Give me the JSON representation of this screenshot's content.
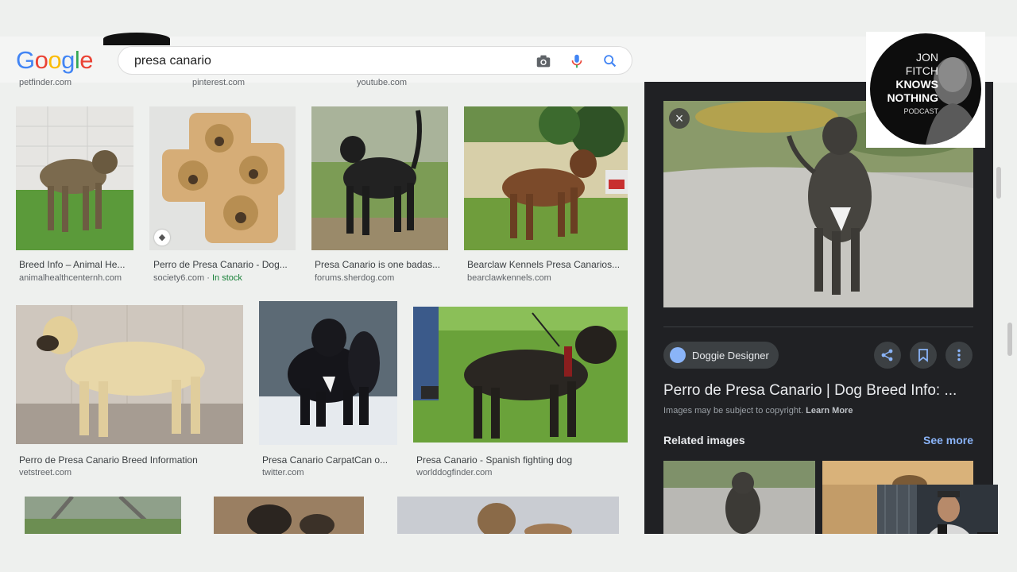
{
  "logo": {
    "text": [
      "G",
      "o",
      "o",
      "g",
      "l",
      "e"
    ],
    "colors": [
      "#4285F4",
      "#EA4335",
      "#FBBC05",
      "#4285F4",
      "#34A853",
      "#EA4335"
    ]
  },
  "search": {
    "query": "presa canario",
    "icons": [
      "camera-icon",
      "mic-icon",
      "search-icon"
    ]
  },
  "top_sources": [
    "petfinder.com",
    "pinterest.com",
    "youtube.com"
  ],
  "results": [
    {
      "caption": "Breed Info – Animal He...",
      "source": "animalhealthcenternh.com"
    },
    {
      "caption": "Perro de Presa Canario - Dog...",
      "source": "society6.com",
      "stock": "In stock"
    },
    {
      "caption": "Presa Canario is one badas...",
      "source": "forums.sherdog.com"
    },
    {
      "caption": "Bearclaw Kennels Presa Canarios...",
      "source": "bearclawkennels.com"
    },
    {
      "caption": "Perro de Presa Canario Breed Information",
      "source": "vetstreet.com"
    },
    {
      "caption": "Presa Canario CarpatCan o...",
      "source": "twitter.com"
    },
    {
      "caption": "Presa Canario - Spanish fighting dog",
      "source": "worlddogfinder.com"
    }
  ],
  "panel": {
    "site": "Doggie Designer",
    "title": "Perro de Presa Canario | Dog Breed Info: ...",
    "copyright": "Images may be subject to copyright.",
    "learn_more": "Learn More",
    "related": "Related images",
    "see_more": "See more",
    "close": "×"
  },
  "badge": {
    "line1": "JON",
    "line2": "FITCH",
    "line3": "KNOWS",
    "line4": "NOTHING",
    "line5": "PODCAST"
  },
  "separator": " · "
}
